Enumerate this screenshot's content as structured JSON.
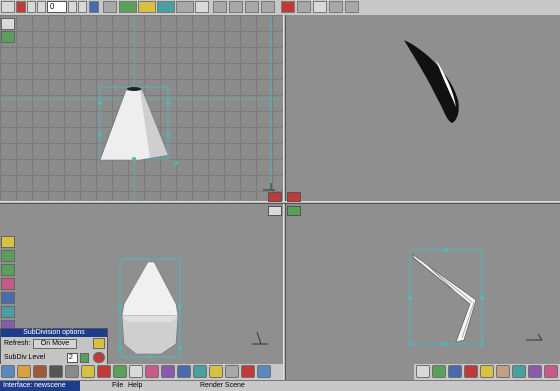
{
  "toolbar": {
    "frame_value": "0"
  },
  "subdivision_panel": {
    "title": "SubDivision options",
    "refresh_label": "Refresh:",
    "on_move_label": "On Move",
    "subdiv_level_label": "SubDiv Level",
    "subdiv_level_value": "2"
  },
  "status": {
    "interface_text": "Interface: newscene",
    "file_menu": "File",
    "help_menu": "Help",
    "render_scene": "Render Scene"
  },
  "colors": {
    "selection_cyan": "#4fb8b8",
    "viewport_gray": "#8f8f8f",
    "title_blue": "#1e3c8c"
  }
}
